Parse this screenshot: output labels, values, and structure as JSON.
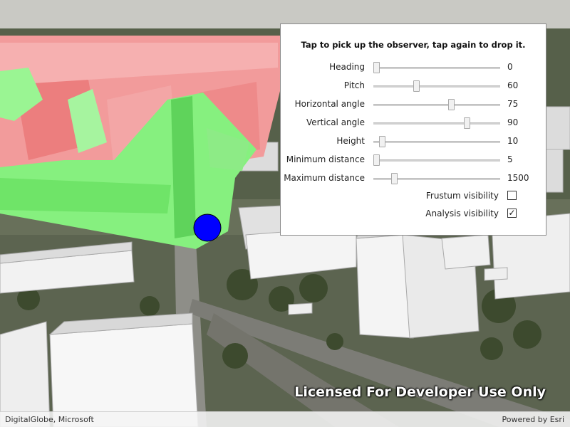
{
  "instruction": "Tap to pick up the observer, tap again to drop it.",
  "controls": {
    "sliders": [
      {
        "label": "Heading",
        "value": "0",
        "fraction": 0.0
      },
      {
        "label": "Pitch",
        "value": "60",
        "fraction": 0.33
      },
      {
        "label": "Horizontal angle",
        "value": "75",
        "fraction": 0.62
      },
      {
        "label": "Vertical angle",
        "value": "90",
        "fraction": 0.75
      },
      {
        "label": "Height",
        "value": "10",
        "fraction": 0.05
      },
      {
        "label": "Minimum distance",
        "value": "5",
        "fraction": 0.0
      },
      {
        "label": "Maximum distance",
        "value": "1500",
        "fraction": 0.15
      }
    ],
    "checkboxes": [
      {
        "label": "Frustum visibility",
        "checked": false,
        "mark": ""
      },
      {
        "label": "Analysis visibility",
        "checked": true,
        "mark": "✓"
      }
    ]
  },
  "watermark": "Licensed For Developer Use Only",
  "footer": {
    "attribution": "DigitalGlobe, Microsoft",
    "powered_by": "Powered by Esri"
  },
  "colors": {
    "visible": "#7ef07a",
    "not_visible": "#f28a8a",
    "observer": "#0000ff"
  }
}
